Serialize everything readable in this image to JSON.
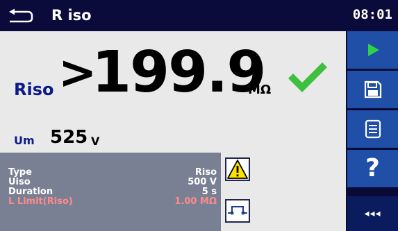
{
  "header": {
    "title": "R iso",
    "time": "08:01"
  },
  "result": {
    "label": "Riso",
    "qualifier": ">",
    "value": "199.9",
    "unit": "MΩ",
    "status_icon": "check-icon",
    "status_color": "#3fbf3f"
  },
  "um": {
    "label": "Um",
    "value": "525",
    "unit": "V"
  },
  "params": [
    {
      "name": "Type",
      "value": "Riso"
    },
    {
      "name": "Uiso",
      "value": "500 V"
    },
    {
      "name": "Duration",
      "value": "5 s"
    },
    {
      "name": "L Limit(Riso)",
      "value": "1.00 MΩ"
    }
  ],
  "side_icons": [
    "warning-icon",
    "probe-connection-icon"
  ],
  "sidebar": {
    "buttons": [
      "start-icon",
      "save-icon",
      "list-icon",
      "help-icon",
      "more-icon"
    ],
    "help_label": "?",
    "more_label": "◂◂◂"
  },
  "colors": {
    "accent": "#1f4fa7",
    "header": "#0b0b3b",
    "label_blue": "#0d1a8a",
    "limit_red": "#ff8a8a",
    "play_green": "#2fd14a"
  }
}
